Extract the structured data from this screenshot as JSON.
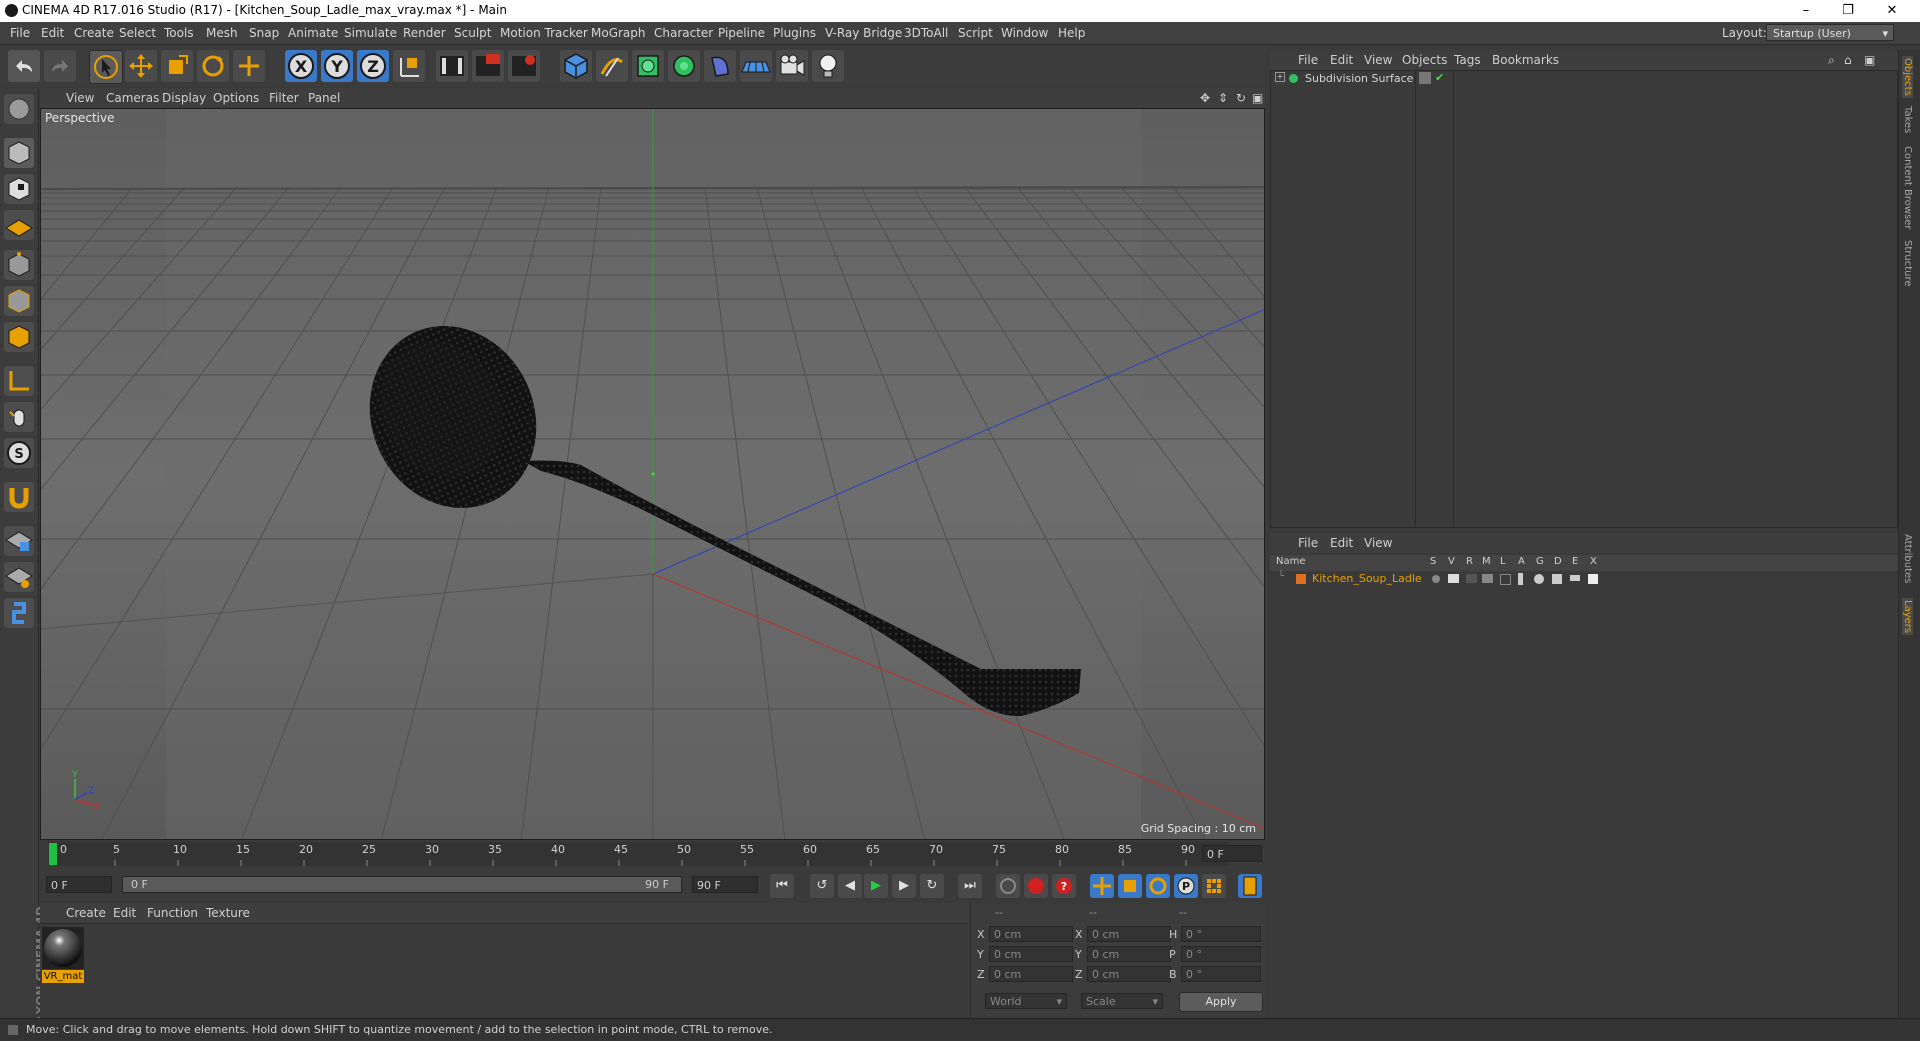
{
  "window": {
    "title": "CINEMA 4D R17.016 Studio (R17) - [Kitchen_Soup_Ladle_max_vray.max *] - Main",
    "minimize": "–",
    "maximize": "❐",
    "close": "✕"
  },
  "menubar": {
    "items": [
      "File",
      "Edit",
      "Create",
      "Select",
      "Tools",
      "Mesh",
      "Snap",
      "Animate",
      "Simulate",
      "Render",
      "Sculpt",
      "Motion Tracker",
      "MoGraph",
      "Character",
      "Pipeline",
      "Plugins",
      "V-Ray Bridge",
      "3DToAll",
      "Script",
      "Window",
      "Help"
    ],
    "layout_label": "Layout:",
    "layout_value": "Startup (User)"
  },
  "toolbar": {
    "icons": [
      "undo-icon",
      "redo-icon",
      "select-cursor-icon",
      "move-icon",
      "scale-icon",
      "rotate-icon",
      "move-axis-icon",
      "x-axis-icon",
      "y-axis-icon",
      "z-axis-icon",
      "world-coords-icon",
      "render-view-icon",
      "render-picture-viewer-icon",
      "edit-render-settings-icon",
      "cube-icon",
      "pen-spline-icon",
      "subdivision-icon",
      "array-icon",
      "deformer-icon",
      "floor-icon",
      "camera-icon",
      "light-icon"
    ],
    "axis_x": "X",
    "axis_y": "Y",
    "axis_z": "Z"
  },
  "left_tools": [
    "make-editable-icon",
    "model-mode-icon",
    "texture-mode-icon",
    "workplane-icon",
    "points-mode-icon",
    "edges-mode-icon",
    "polygons-mode-icon",
    "axis-mode-icon",
    "tweak-icon",
    "snap-s-icon",
    "magnet-icon",
    "grid-lock-icon",
    "grid-settings-icon",
    "python-icon"
  ],
  "viewport": {
    "menu": [
      "View",
      "Cameras",
      "Display",
      "Options",
      "Filter",
      "Panel"
    ],
    "label": "Perspective",
    "grid_spacing": "Grid Spacing : 10 cm"
  },
  "timeline": {
    "ticks": [
      "0",
      "5",
      "10",
      "15",
      "20",
      "25",
      "30",
      "35",
      "40",
      "45",
      "50",
      "55",
      "60",
      "65",
      "70",
      "75",
      "80",
      "85",
      "90"
    ],
    "current_frame": "0 F",
    "start_frame": "0 F",
    "range_start": "0 F",
    "range_end": "90 F",
    "end_frame": "90 F"
  },
  "playback": {
    "go_start": "⏮",
    "prev_key": "↺",
    "prev_frame": "◀",
    "play": "▶",
    "next_frame": "▶",
    "loop": "↻",
    "go_end": "⏭"
  },
  "material_manager": {
    "menu": [
      "Create",
      "Edit",
      "Function",
      "Texture"
    ],
    "materials": [
      {
        "name": "VR_mat"
      }
    ]
  },
  "coordinates": {
    "header": [
      "--",
      "--",
      "--"
    ],
    "rows": [
      {
        "a": "X",
        "av": "0 cm",
        "b": "X",
        "bv": "0 cm",
        "c": "H",
        "cv": "0 °"
      },
      {
        "a": "Y",
        "av": "0 cm",
        "b": "Y",
        "bv": "0 cm",
        "c": "P",
        "cv": "0 °"
      },
      {
        "a": "Z",
        "av": "0 cm",
        "b": "Z",
        "bv": "0 cm",
        "c": "B",
        "cv": "0 °"
      }
    ],
    "mode_world": "World",
    "mode_scale": "Scale",
    "apply": "Apply"
  },
  "object_manager": {
    "menu": [
      "File",
      "Edit",
      "View",
      "Objects",
      "Tags",
      "Bookmarks"
    ],
    "objects": [
      {
        "name": "Subdivision Surface"
      }
    ]
  },
  "layer_manager": {
    "menu": [
      "File",
      "Edit",
      "View"
    ],
    "columns": [
      "Name",
      "S",
      "V",
      "R",
      "M",
      "L",
      "A",
      "G",
      "D",
      "E",
      "X"
    ],
    "layers": [
      {
        "name": "Kitchen_Soup_Ladle",
        "color": "#e07020"
      }
    ]
  },
  "side_tabs": [
    "Objects",
    "Takes",
    "Content Browser",
    "Structure",
    "Attributes",
    "Layers"
  ],
  "status": "Move: Click and drag to move elements. Hold down SHIFT to quantize movement / add to the selection in point mode, CTRL to remove.",
  "brand": "MAXON CINEMA 4D",
  "colors": {
    "accent": "#e8a000",
    "active_tool": "#3a78c8",
    "ladle_dark": "#151515"
  }
}
